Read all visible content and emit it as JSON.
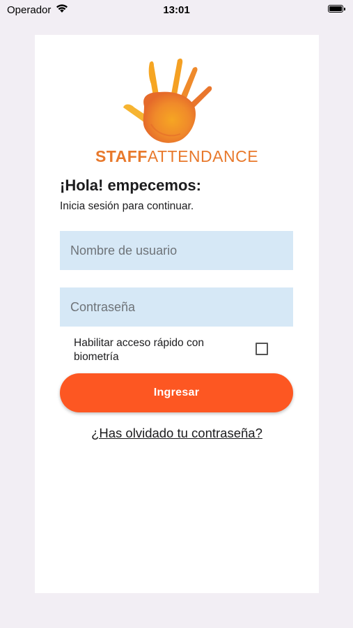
{
  "status_bar": {
    "carrier": "Operador",
    "time": "13:01"
  },
  "logo": {
    "brand_bold": "STAFF",
    "brand_light": "ATTENDANCE",
    "colors": {
      "primary": "#e8792c",
      "accent": "#f6a623"
    }
  },
  "login": {
    "greeting": "¡Hola! empecemos:",
    "subtitle": "Inicia sesión para continuar.",
    "username_placeholder": "Nombre de usuario",
    "password_placeholder": "Contraseña",
    "biometric_label": "Habilitar acceso rápido con biometría",
    "biometric_checked": false,
    "submit_label": "Ingresar",
    "forgot_password": "¿Has olvidado tu contraseña?"
  },
  "colors": {
    "button": "#fd5722",
    "input_background": "#d6e8f6",
    "page_background": "#f2eef4"
  }
}
